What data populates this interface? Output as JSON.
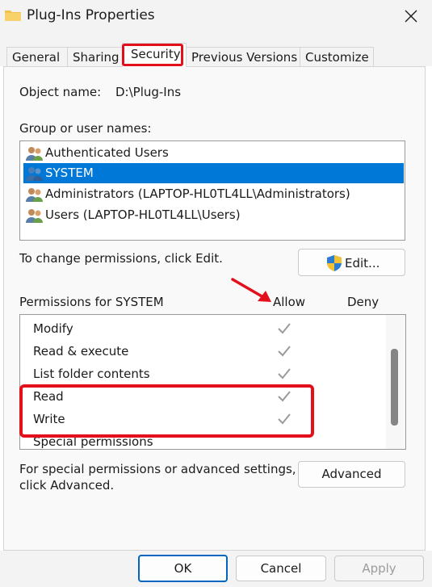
{
  "window": {
    "title": "Plug-Ins Properties"
  },
  "tabs": [
    {
      "label": "General"
    },
    {
      "label": "Sharing"
    },
    {
      "label": "Security",
      "selected": true
    },
    {
      "label": "Previous Versions"
    },
    {
      "label": "Customize"
    }
  ],
  "object": {
    "label": "Object name:",
    "value": "D:\\Plug-Ins"
  },
  "users": {
    "label": "Group or user names:",
    "items": [
      {
        "label": "Authenticated Users",
        "selected": false
      },
      {
        "label": "SYSTEM",
        "selected": true
      },
      {
        "label": "Administrators (LAPTOP-HL0TL4LL\\Administrators)",
        "selected": false
      },
      {
        "label": "Users (LAPTOP-HL0TL4LL\\Users)",
        "selected": false
      }
    ]
  },
  "edit": {
    "hint": "To change permissions, click Edit.",
    "button_label": "Edit..."
  },
  "permissions": {
    "label": "Permissions for SYSTEM",
    "allow_label": "Allow",
    "deny_label": "Deny",
    "items": [
      {
        "name": "Modify",
        "allow": true,
        "deny": false
      },
      {
        "name": "Read & execute",
        "allow": true,
        "deny": false
      },
      {
        "name": "List folder contents",
        "allow": true,
        "deny": false
      },
      {
        "name": "Read",
        "allow": true,
        "deny": false
      },
      {
        "name": "Write",
        "allow": true,
        "deny": false
      },
      {
        "name": "Special permissions",
        "allow": false,
        "deny": false
      }
    ]
  },
  "advanced": {
    "hint_line1": "For special permissions or advanced settings,",
    "hint_line2": "click Advanced.",
    "button_label": "Advanced"
  },
  "footer": {
    "ok_label": "OK",
    "cancel_label": "Cancel",
    "apply_label": "Apply"
  },
  "colors": {
    "accent": "#0078d7",
    "highlight": "#e3101b",
    "check": "#9a9a9a"
  }
}
